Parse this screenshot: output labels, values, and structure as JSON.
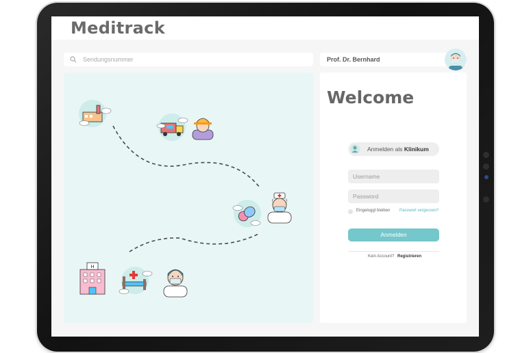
{
  "app": {
    "brand": "Meditrack"
  },
  "search": {
    "placeholder": "Sendungsnummer"
  },
  "user": {
    "name": "Prof. Dr. Bernhard"
  },
  "login": {
    "title": "Welcome",
    "role_prefix": "Anmelden als ",
    "role_name": "Klinikum",
    "username_placeholder": "Username",
    "password_placeholder": "Password",
    "remember_label": "Eingeloggt bleiben",
    "forgot_label": "Passwort vergessen?",
    "submit_label": "Anmelden",
    "no_account_text": "Kein Account? ",
    "register_label": "Registrieren"
  },
  "theme": {
    "accent": "#74c7cb",
    "map_background": "#e8f6f6",
    "brand_text": "#6a6a6a",
    "link": "#4fb7c0"
  },
  "map": {
    "icons": [
      "factory-icon",
      "delivery-truck-icon",
      "worker-icon",
      "pill-icon",
      "nurse-icon",
      "hospital-icon",
      "hospital-bed-icon",
      "doctor-icon"
    ]
  }
}
